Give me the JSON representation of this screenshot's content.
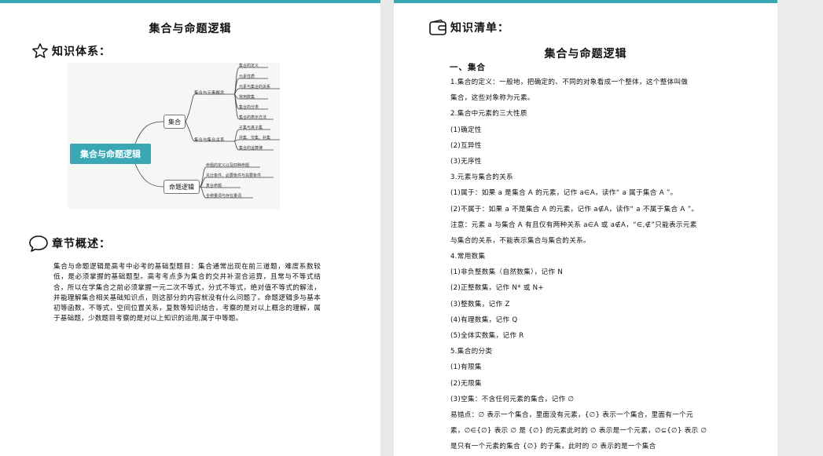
{
  "left_page": {
    "title": "集合与命题逻辑",
    "knowledge_system_heading": "知识体系：",
    "chapter_overview_heading": "章节概述：",
    "mindmap": {
      "root": "集合与命题逻辑",
      "branches": [
        {
          "label": "集合",
          "groups": [
            {
              "label": "集合与元素概念",
              "leaves": [
                "集合的定义",
                "元素性质",
                "元素与集合的关系",
                "常用数集",
                "集合的分类",
                "集合的表示方法"
              ]
            },
            {
              "label": "集合与集合关系",
              "leaves": [
                "子集与真子集",
                "并集、交集、补集",
                "集合的运算律"
              ]
            }
          ]
        },
        {
          "label": "命题逻辑",
          "leaves": [
            "命题的定义以及四种命题",
            "充分条件、必要条件与充要条件",
            "复合命题",
            "全称量词与存在量词"
          ]
        }
      ]
    },
    "overview_text": "集合与命题逻辑是高考中必考的基础型题目：集合通常出现在前三道题，难度系数较低，是必须掌握的基础题型。高考考点多为集合的交并补混合运算，且常与不等式结合，所以在学集合之前必须掌握一元二次不等式，分式不等式，绝对值不等式的解法，并能理解集合相关基础知识点，则这部分的内容就没有什么问题了。命题逻辑多与基本初等函数，不等式，空间位置关系，复数等知识结合，考察的是对以上概念的理解，属于基础题，少数题目考察的是对以上知识的运用,属于中等题。"
  },
  "right_page": {
    "heading": "知识清单：",
    "title": "集合与命题逻辑",
    "section1": "一、集合",
    "lines": [
      "1.集合的定义：一般地，把确定的、不同的对象看成一个整体，这个整体叫做",
      "集合，这些对象称为元素。",
      "2.集合中元素的三大性质",
      "(1)确定性",
      "(2)互异性",
      "(3)无序性",
      "3.元素与集合的关系",
      "(1)属于：如果 a 是集合 A 的元素，记作 a∈A，读作“ a 属于集合 A ”。",
      "(2)不属于：如果 a 不是集合 A 的元素，记作 a∉A，读作“ a 不属于集合 A ”。",
      "注意：元素 a 与集合 A 有且仅有两种关系 a∈A 或 a∉A，“∈,∉”只能表示元素",
      "与集合的关系，不能表示集合与集合的关系。",
      "4.常用数集",
      "(1)非负整数集（自然数集），记作 N",
      "(2)正整数集，记作 N* 或 N+",
      "(3)整数集，记作 Z",
      "(4)有理数集，记作 Q",
      "(5)全体实数集，记作 R",
      "5.集合的分类",
      "(1)有限集",
      "(2)无限集",
      "(3)空集：不含任何元素的集合，记作 ∅",
      "易错点：∅ 表示一个集合，里面没有元素，{∅} 表示一个集合，里面有一个元",
      "素，∅∈{∅} 表示 ∅ 是 {∅} 的元素此时的 ∅ 表示是一个元素，∅⊆{∅} 表示 ∅",
      "是只有一个元素的集合 {∅} 的子集，此时的 ∅ 表示的是一个集合"
    ]
  },
  "colors": {
    "accent": "#3aa8b4",
    "page_bg": "#ffffff",
    "viewer_bg": "#e9e9e9"
  },
  "icons": {
    "knowledge_system": "star-outline-icon",
    "chapter_overview": "speech-bubble-icon",
    "knowledge_list": "wallet-icon"
  }
}
